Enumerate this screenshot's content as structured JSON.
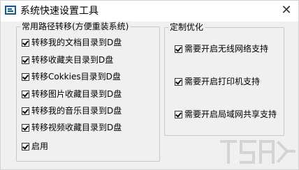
{
  "window": {
    "title": "系统快速设置工具",
    "close_glyph": "✕"
  },
  "left_group": {
    "legend": "常用路径转移(方便重装系统)",
    "items": [
      {
        "label": "转移我的文档目录到D盘",
        "checked": true
      },
      {
        "label": "转移收藏夹目录到D盘",
        "checked": true
      },
      {
        "label": "转移Cokkies目录到D盘",
        "checked": true
      },
      {
        "label": "转移图片收藏目录到D盘",
        "checked": true
      },
      {
        "label": "转移我的音乐目录到D盘",
        "checked": true
      },
      {
        "label": "转移视频收藏目录到D盘",
        "checked": true
      },
      {
        "label": "启用",
        "checked": true
      }
    ]
  },
  "right_group": {
    "legend": "定制优化",
    "items": [
      {
        "label": "需要开启无线网络支持",
        "checked": true
      },
      {
        "label": "需要开启打印机支持",
        "checked": true
      },
      {
        "label": "需要开启局域网共享支持",
        "checked": true
      }
    ]
  },
  "colors": {
    "window_bg": "#f0f0f0",
    "titlebar_bg": "#ffffff",
    "icon_blue": "#0b5aa8",
    "group_border": "#c8c8c8"
  }
}
